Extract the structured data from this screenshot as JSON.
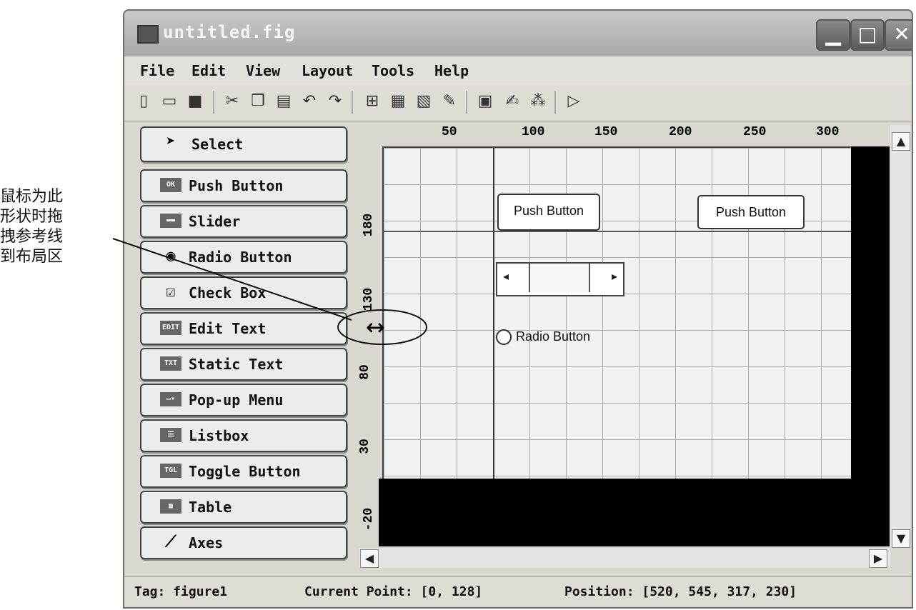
{
  "annotation": {
    "lines": [
      "鼠标为此",
      "形状时拖",
      "拽参考线",
      "到布局区"
    ],
    "cursor_glyph": "↔"
  },
  "window": {
    "title": "untitled.fig",
    "controls": {
      "minimize": "▁",
      "maximize": "□",
      "close": "✕"
    }
  },
  "menu": {
    "items": [
      "File",
      "Edit",
      "View",
      "Layout",
      "Tools",
      "Help"
    ]
  },
  "toolbar": {
    "icons": [
      "new-file-icon",
      "open-folder-icon",
      "save-icon",
      "cut-icon",
      "copy-icon",
      "paste-icon",
      "undo-icon",
      "redo-icon",
      "align-icon",
      "menu-editor-icon",
      "tab-order-icon",
      "toolbar-editor-icon",
      "m-file-editor-icon",
      "property-inspector-icon",
      "object-browser-icon",
      "run-icon"
    ]
  },
  "palette": {
    "items": [
      {
        "label": "Select",
        "icon": "select-arrow-icon",
        "glyph": "➤"
      },
      {
        "label": "Push Button",
        "icon": "push-button-icon",
        "glyph": "OK"
      },
      {
        "label": "Slider",
        "icon": "slider-icon",
        "glyph": "▬▬"
      },
      {
        "label": "Radio Button",
        "icon": "radio-button-icon",
        "glyph": "◉"
      },
      {
        "label": "Check Box",
        "icon": "check-box-icon",
        "glyph": "☑"
      },
      {
        "label": "Edit Text",
        "icon": "edit-text-icon",
        "glyph": "EDIT"
      },
      {
        "label": "Static Text",
        "icon": "static-text-icon",
        "glyph": "TXT"
      },
      {
        "label": "Pop-up Menu",
        "icon": "popup-menu-icon",
        "glyph": "▭▾"
      },
      {
        "label": "Listbox",
        "icon": "listbox-icon",
        "glyph": "☰"
      },
      {
        "label": "Toggle Button",
        "icon": "toggle-button-icon",
        "glyph": "TGL"
      },
      {
        "label": "Table",
        "icon": "table-icon",
        "glyph": "▦"
      },
      {
        "label": "Axes",
        "icon": "axes-icon",
        "glyph": "⟋"
      }
    ]
  },
  "rulers": {
    "top": [
      "50",
      "100",
      "150",
      "200",
      "250",
      "300"
    ],
    "left": [
      "180",
      "130",
      "80",
      "30",
      "-20"
    ]
  },
  "canvas": {
    "push_button_1": "Push Button",
    "push_button_2": "Push Button",
    "slider_left": "◂",
    "slider_right": "▸",
    "radio_label": "Radio Button"
  },
  "scroll": {
    "up": "▲",
    "down": "▼",
    "left": "◀",
    "right": "▶"
  },
  "status": {
    "tag": "Tag: figure1",
    "current_point": "Current Point:  [0, 128]",
    "position": "Position: [520, 545, 317, 230]"
  }
}
